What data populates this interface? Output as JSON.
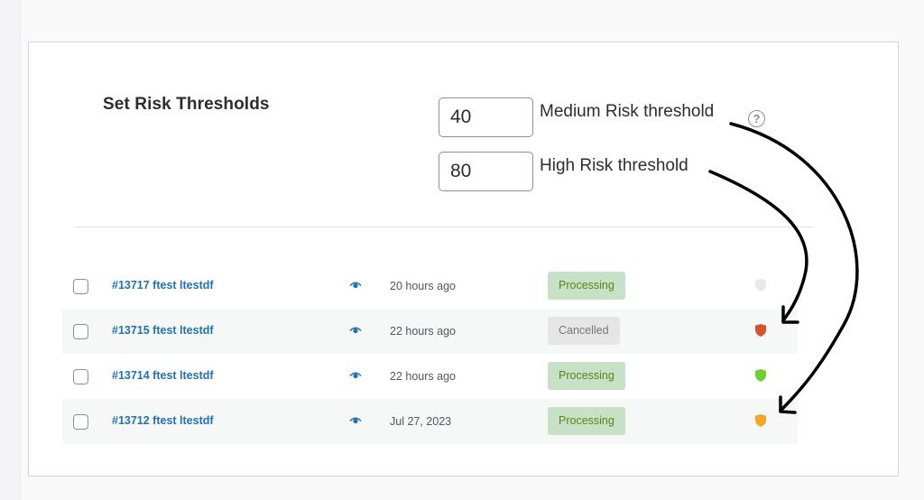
{
  "settings": {
    "title": "Set Risk Thresholds",
    "medium": {
      "value": "40",
      "label": "Medium Risk threshold"
    },
    "high": {
      "value": "80",
      "label": "High Risk threshold"
    },
    "help_glyph": "?"
  },
  "orders": [
    {
      "id_name": "#13717 ftest ltestdf",
      "date": "20 hours ago",
      "status": "Processing",
      "risk_level": "none",
      "risk_color": "#e8e8e8"
    },
    {
      "id_name": "#13715 ftest ltestdf",
      "date": "22 hours ago",
      "status": "Cancelled",
      "risk_level": "high",
      "risk_color": "#d6532b"
    },
    {
      "id_name": "#13714 ftest ltestdf",
      "date": "22 hours ago",
      "status": "Processing",
      "risk_level": "low",
      "risk_color": "#6fcf2f"
    },
    {
      "id_name": "#13712 ftest ltestdf",
      "date": "Jul 27, 2023",
      "status": "Processing",
      "risk_level": "medium",
      "risk_color": "#f5a623"
    }
  ],
  "colors": {
    "link": "#2271b1",
    "processing_bg": "#c6e1c6",
    "processing_text": "#5b841b",
    "cancelled_bg": "#e5e5e5",
    "cancelled_text": "#777777"
  }
}
